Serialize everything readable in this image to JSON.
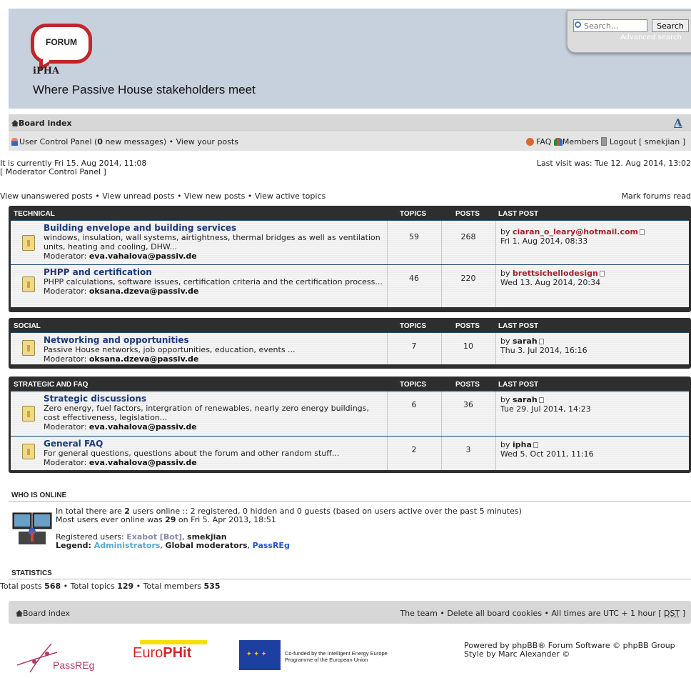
{
  "header": {
    "logo_text": "FORUM",
    "logo_org": "iPHA",
    "site_description": "Where Passive House stakeholders meet",
    "search_placeholder": "Search…",
    "search_button": "Search",
    "advanced_search": "Advanced search"
  },
  "nav": {
    "board_index": "Board index",
    "ucp_prefix": "User Control Panel (",
    "new_messages_count": "0",
    "ucp_suffix": " new messages) • View your posts",
    "faq": "FAQ",
    "members": "Members",
    "logout": "Logout [ smekjian ]"
  },
  "status": {
    "current_time": "It is currently Fri 15. Aug 2014, 11:08",
    "mcp": "[ Moderator Control Panel ]",
    "last_visit": "Last visit was: Tue 12. Aug 2014, 13:02",
    "search_links": "View unanswered posts • View unread posts • View new posts • View active topics",
    "mark_read": "Mark forums read"
  },
  "columns": {
    "topics": "TOPICS",
    "posts": "POSTS",
    "last_post": "LAST POST"
  },
  "categories": [
    {
      "name": "Technical",
      "forums": [
        {
          "title": "Building envelope and building services",
          "description": "windows, insulation, wall systems, airtightness, thermal bridges as well as ventilation units, heating and cooling, DHW...",
          "moderator_label": "Moderator:",
          "moderator": "eva.vahalova@passiv.de",
          "topics": "59",
          "posts": "268",
          "last_by": "ciaran_o_leary@hotmail.com",
          "last_date": "Fri 1. Aug 2014, 08:33"
        },
        {
          "title": "PHPP and certification",
          "description": "PHPP calculations, software issues, certification criteria and the certification process...",
          "moderator_label": "Moderator:",
          "moderator": "oksana.dzeva@passiv.de",
          "topics": "46",
          "posts": "220",
          "last_by": "brettsichellodesign",
          "last_date": "Wed 13. Aug 2014, 20:34"
        }
      ]
    },
    {
      "name": "Social",
      "forums": [
        {
          "title": "Networking and opportunities",
          "description": "Passive House networks, job opportunities, education, events ...",
          "moderator_label": "Moderator:",
          "moderator": "oksana.dzeva@passiv.de",
          "topics": "7",
          "posts": "10",
          "last_by": "sarah",
          "last_date": "Thu 3. Jul 2014, 16:16"
        }
      ]
    },
    {
      "name": "Strategic and FAQ",
      "forums": [
        {
          "title": "Strategic discussions",
          "description": "Zero energy, fuel factors, intergration of renewables, nearly zero energy buildings, cost effectiveness, legislation...",
          "moderator_label": "Moderator:",
          "moderator": "eva.vahalova@passiv.de",
          "topics": "6",
          "posts": "36",
          "last_by": "sarah",
          "last_date": "Tue 29. Jul 2014, 14:23"
        },
        {
          "title": "General FAQ",
          "description": "For general questions, questions about the forum and other random stuff...",
          "moderator_label": "Moderator:",
          "moderator": "eva.vahalova@passiv.de",
          "topics": "2",
          "posts": "3",
          "last_by": "ipha",
          "last_date": "Wed 5. Oct 2011, 11:16"
        }
      ]
    }
  ],
  "online": {
    "title": "WHO IS ONLINE",
    "line1_a": "In total there are ",
    "total_users": "2",
    "line1_b": " users online :: 2 registered, 0 hidden and 0 guests (based on users active over the past 5 minutes)",
    "line2_a": "Most users ever online was ",
    "max_users": "29",
    "line2_b": " on Fri 5. Apr 2013, 18:51",
    "registered_label": "Registered users: ",
    "user1": "Exabot [Bot]",
    "user2": "smekjian",
    "legend_label": "Legend: ",
    "legend1": "Administrators",
    "legend2": "Global moderators",
    "legend3": "PassREg"
  },
  "statistics": {
    "title": "STATISTICS",
    "posts_label": "Total posts ",
    "posts": "568",
    "topics_label": " • Total topics ",
    "topics": "129",
    "members_label": " • Total members ",
    "members": "535"
  },
  "footer": {
    "board_index": "Board index",
    "links_text": "The team • Delete all board cookies • All times are UTC + 1 hour [ ",
    "dst": "DST",
    "links_end": " ]",
    "passreg": "PassREg",
    "europhit_a": "Euro",
    "europhit_b": "PHit",
    "eu_line1": "Co-funded by the Intelligent Energy Europe",
    "eu_line2": "Programme of the European Union",
    "powered1": "Powered by phpBB® Forum Software © phpBB Group",
    "powered2": "Style by Marc Alexander ©"
  }
}
